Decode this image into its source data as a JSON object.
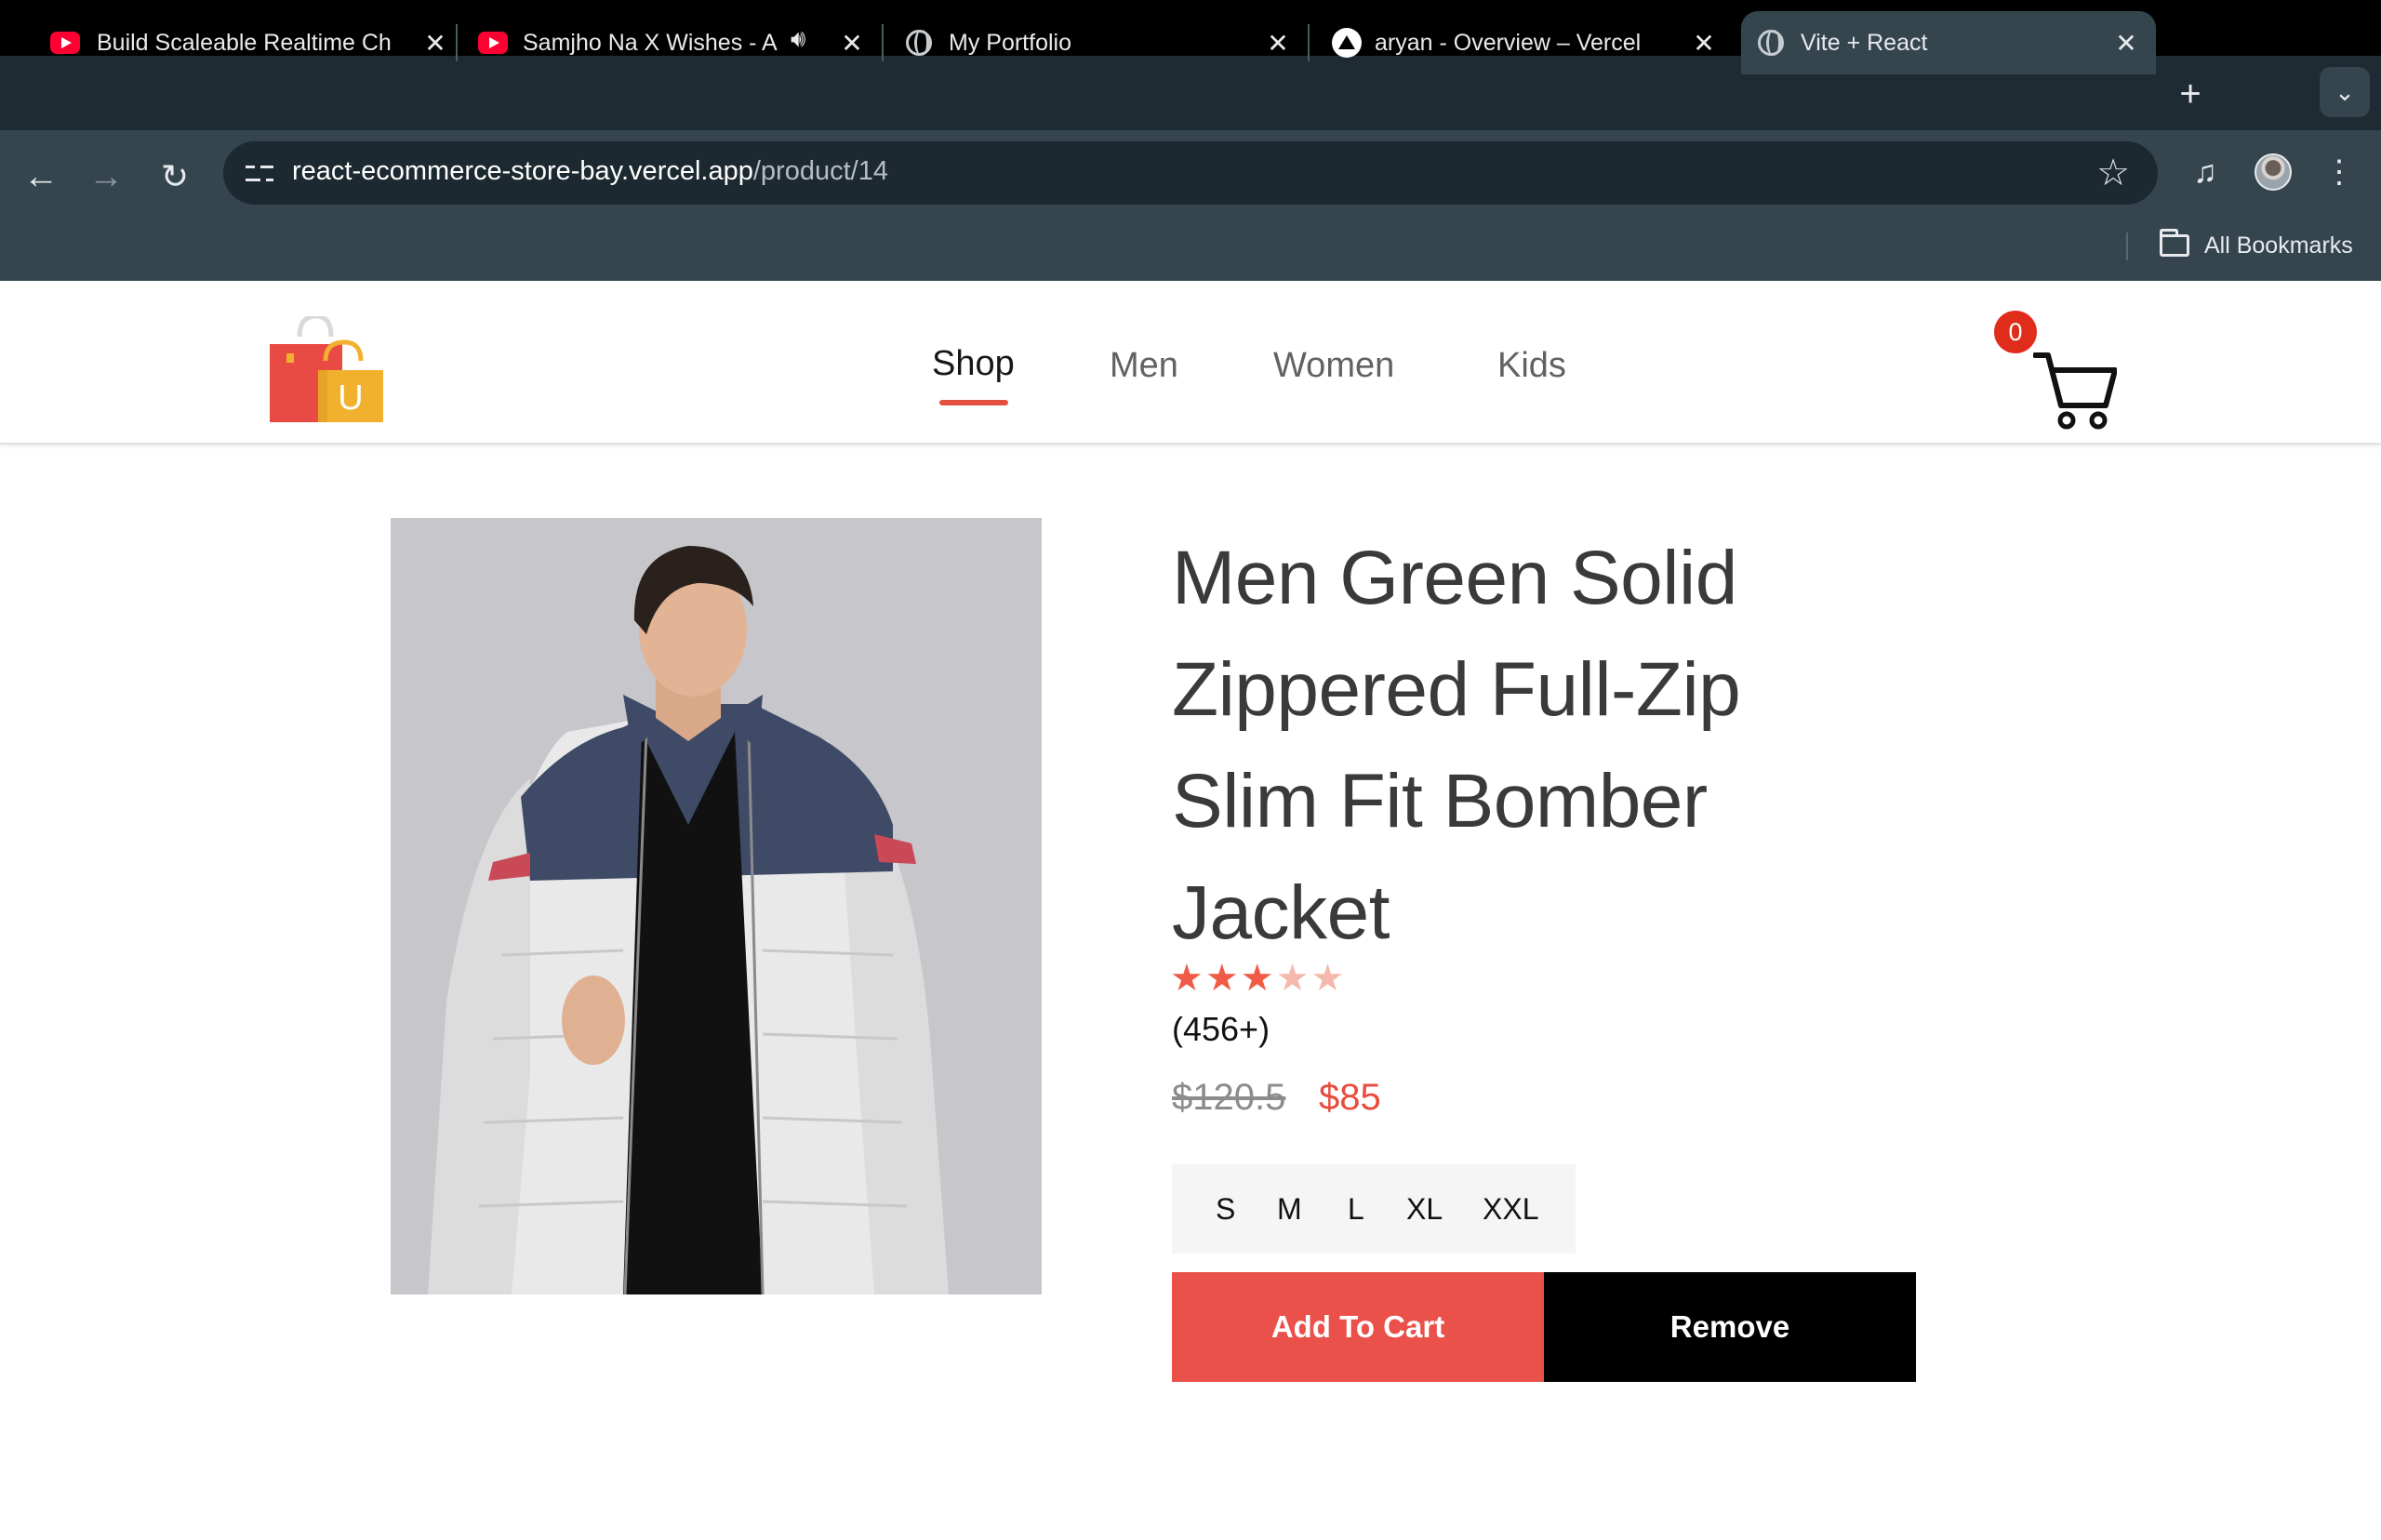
{
  "browser": {
    "tabs": [
      {
        "title": "Build Scaleable Realtime Ch",
        "favicon": "youtube-icon"
      },
      {
        "title": "Samjho Na X Wishes - A",
        "favicon": "youtube-icon",
        "audio": "speaker-icon"
      },
      {
        "title": "My Portfolio",
        "favicon": "globe-icon"
      },
      {
        "title": "aryan - Overview – Vercel",
        "favicon": "vercel-icon"
      },
      {
        "title": "Vite + React",
        "favicon": "globe-icon",
        "active": true
      }
    ],
    "address": {
      "host": "react-ecommerce-store-bay.vercel.app",
      "path": "/product/14"
    },
    "bookmarks_label": "All Bookmarks"
  },
  "header": {
    "logo_letter": "U",
    "nav": [
      "Shop",
      "Men",
      "Women",
      "Kids"
    ],
    "active_nav": "Shop",
    "cart_count": "0"
  },
  "product": {
    "title_lines": [
      "Men Green Solid",
      "Zippered Full-Zip",
      "Slim Fit Bomber",
      "Jacket"
    ],
    "rating": 3,
    "rating_max": 5,
    "reviews": "(456+)",
    "old_price": "$120.5",
    "new_price": "$85",
    "sizes": [
      "S",
      "M",
      "L",
      "XL",
      "XXL"
    ],
    "add_to_cart_label": "Add To Cart",
    "remove_label": "Remove"
  },
  "colors": {
    "accent": "#e84c3d",
    "add_button": "#e9514a",
    "remove_button": "#000000",
    "chrome_dark": "#1f2b32",
    "chrome_toolbar": "#35454e"
  }
}
